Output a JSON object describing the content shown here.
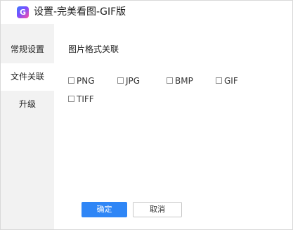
{
  "window": {
    "title": "设置-完美看图-GIF版",
    "logo_letter": "G"
  },
  "sidebar": {
    "items": [
      {
        "label": "常规设置",
        "active": false
      },
      {
        "label": "文件关联",
        "active": true
      },
      {
        "label": "升级",
        "active": false
      }
    ]
  },
  "main": {
    "section_title": "图片格式关联",
    "formats": [
      {
        "label": "PNG",
        "checked": false
      },
      {
        "label": "JPG",
        "checked": false
      },
      {
        "label": "BMP",
        "checked": false
      },
      {
        "label": "GIF",
        "checked": false
      },
      {
        "label": "TIFF",
        "checked": false
      }
    ]
  },
  "buttons": {
    "ok_label": "确定",
    "cancel_label": "取消"
  },
  "colors": {
    "accent": "#2f86f6",
    "sidebar_bg": "#f2f2f2",
    "active_item_bg": "#ffffff"
  }
}
